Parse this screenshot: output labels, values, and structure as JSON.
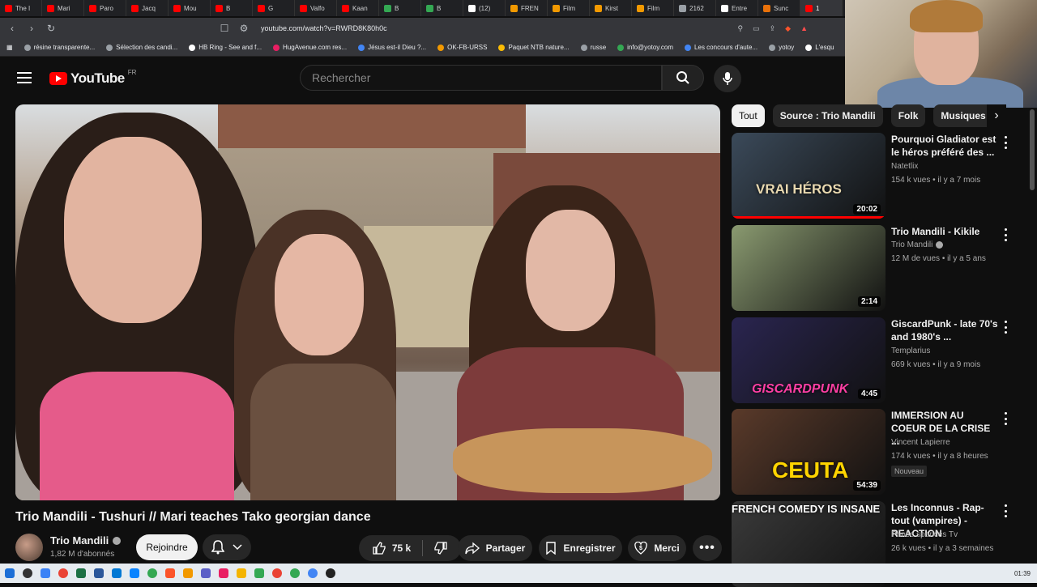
{
  "browser": {
    "tabs": [
      {
        "label": "The I",
        "color": "#ff0000"
      },
      {
        "label": "Mari",
        "color": "#ff0000"
      },
      {
        "label": "Paro",
        "color": "#ff0000"
      },
      {
        "label": "Jacq",
        "color": "#ff0000"
      },
      {
        "label": "Mou",
        "color": "#ff0000"
      },
      {
        "label": "B",
        "color": "#ff0000"
      },
      {
        "label": "G",
        "color": "#ff0000"
      },
      {
        "label": "Valfo",
        "color": "#ff0000"
      },
      {
        "label": "Kaan",
        "color": "#ff0000"
      },
      {
        "label": "B",
        "color": "#34a853"
      },
      {
        "label": "B",
        "color": "#34a853"
      },
      {
        "label": "(12)",
        "color": "#ffffff"
      },
      {
        "label": "FREN",
        "color": "#f29900"
      },
      {
        "label": "Film",
        "color": "#f29900"
      },
      {
        "label": "Kirst",
        "color": "#f29900"
      },
      {
        "label": "Film",
        "color": "#f29900"
      },
      {
        "label": "2162",
        "color": "#9aa0a6"
      },
      {
        "label": "Entre",
        "color": "#ffffff"
      },
      {
        "label": "Sunc",
        "color": "#e8710a"
      },
      {
        "label": "1",
        "color": "#ff0000"
      }
    ],
    "url": "youtube.com/watch?v=RWRD8K80h0c",
    "bookmarks": [
      {
        "label": "résine transparente...",
        "color": "#9aa0a6"
      },
      {
        "label": "Sélection des candi...",
        "color": "#9aa0a6"
      },
      {
        "label": "HB Ring - See and f...",
        "color": "#ffffff"
      },
      {
        "label": "HugAvenue.com res...",
        "color": "#e91e63"
      },
      {
        "label": "Jésus est-il Dieu ?...",
        "color": "#4285f4"
      },
      {
        "label": "OK-FB-URSS",
        "color": "#f29900"
      },
      {
        "label": "Paquet NTB nature...",
        "color": "#fbbc04"
      },
      {
        "label": "russe",
        "color": "#9aa0a6"
      },
      {
        "label": "info@yotoy.com",
        "color": "#34a853"
      },
      {
        "label": "Les concours d'aute...",
        "color": "#4285f4"
      },
      {
        "label": "yotoy",
        "color": "#9aa0a6"
      },
      {
        "label": "L'esqu",
        "color": "#ffffff"
      }
    ]
  },
  "youtube": {
    "logo_text": "YouTube",
    "country": "FR",
    "search_placeholder": "Rechercher"
  },
  "video": {
    "title": "Trio Mandili - Tushuri // Mari teaches Tako georgian dance",
    "channel": "Trio Mandili",
    "subscribers": "1,82 M d'abonnés",
    "join_label": "Rejoindre",
    "likes": "75 k",
    "share_label": "Partager",
    "save_label": "Enregistrer",
    "thanks_label": "Merci"
  },
  "chips": [
    "Tout",
    "Source : Trio Mandili",
    "Folk",
    "Musiques v"
  ],
  "recommendations": [
    {
      "title": "Pourquoi Gladiator est le héros préféré des ...",
      "channel": "Natetlix",
      "meta": "154 k vues • il y a 7 mois",
      "duration": "20:02",
      "thumb_text": "VRAI HÉROS",
      "watched": 1.0,
      "verified": false,
      "badge": "",
      "thumb_color": "#3b4a5a"
    },
    {
      "title": "Trio Mandili - Kikile",
      "channel": "Trio Mandili",
      "meta": "12 M de vues • il y a 5 ans",
      "duration": "2:14",
      "thumb_text": "",
      "watched": 0.0,
      "verified": true,
      "badge": "",
      "thumb_color": "#8a9a70"
    },
    {
      "title": "GiscardPunk - late 70's and 1980's ...",
      "channel": "Templarius",
      "meta": "669 k vues • il y a 9 mois",
      "duration": "4:45",
      "thumb_text": "GISCARDPUNK",
      "watched": 0.0,
      "verified": false,
      "badge": "",
      "thumb_color": "#2a2550"
    },
    {
      "title": "IMMERSION AU COEUR DE LA CRISE ...",
      "channel": "Vincent Lapierre",
      "meta": "174 k vues • il y a 8 heures",
      "duration": "54:39",
      "thumb_text": "CEUTA",
      "watched": 0.0,
      "verified": false,
      "badge": "Nouveau",
      "thumb_color": "#5a3a2a"
    },
    {
      "title": "Les Inconnus - Rap-tout (vampires) - REACTION",
      "channel": "Prince sparkles Tv",
      "meta": "26 k vues • il y a 3 semaines",
      "duration": "",
      "thumb_text": "FRENCH COMEDY IS INSANE",
      "watched": 0.0,
      "verified": false,
      "badge": "",
      "thumb_color": "#3a3a3a"
    }
  ],
  "taskbar": {
    "clock": "01:39"
  }
}
